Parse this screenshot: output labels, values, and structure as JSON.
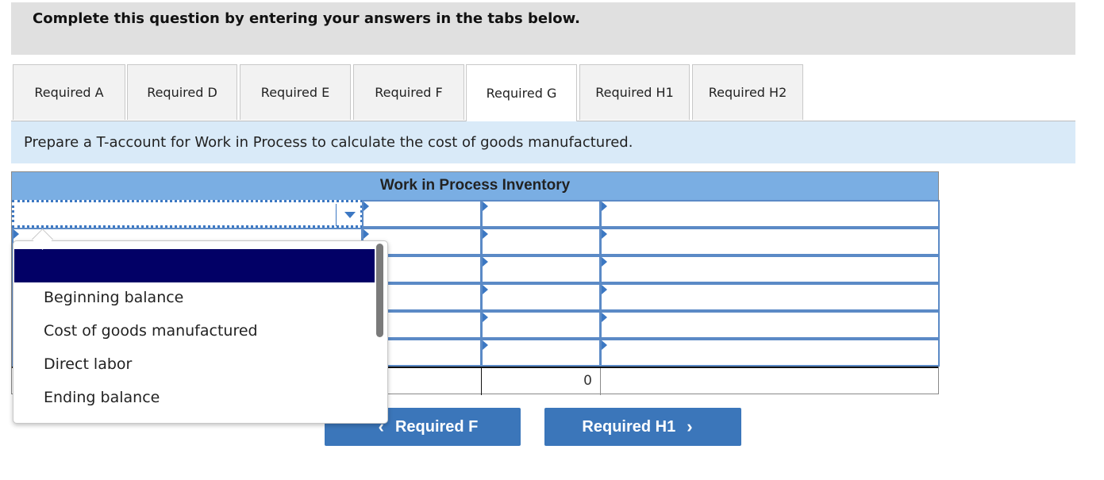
{
  "instruction": "Complete this question by entering your answers in the tabs below.",
  "tabs": [
    {
      "label": "Required A",
      "active": false
    },
    {
      "label": "Required D",
      "active": false
    },
    {
      "label": "Required E",
      "active": false
    },
    {
      "label": "Required F",
      "active": false
    },
    {
      "label": "Required G",
      "active": true
    },
    {
      "label": "Required H1",
      "active": false
    },
    {
      "label": "Required H2",
      "active": false
    }
  ],
  "prompt": "Prepare a T-account for Work in Process to calculate the cost of goods manufactured.",
  "taccount": {
    "title": "Work in Process Inventory",
    "rows": [
      {
        "label": "",
        "debit": "",
        "credit": "",
        "right_label": ""
      },
      {
        "label": "",
        "debit": "",
        "credit": "",
        "right_label": ""
      },
      {
        "label": "",
        "debit": "",
        "credit": "",
        "right_label": ""
      },
      {
        "label": "",
        "debit": "",
        "credit": "",
        "right_label": ""
      },
      {
        "label": "",
        "debit": "",
        "credit": "",
        "right_label": ""
      },
      {
        "label": "",
        "debit": "",
        "credit": "",
        "right_label": ""
      }
    ],
    "total_credit": "0"
  },
  "dropdown": {
    "highlighted": "",
    "options": [
      "Beginning balance",
      "Cost of goods manufactured",
      "Direct labor",
      "Ending balance"
    ]
  },
  "nav": {
    "prev_label": "Required F",
    "prev_icon": "‹",
    "next_label": "Required H1",
    "next_icon": "›"
  }
}
